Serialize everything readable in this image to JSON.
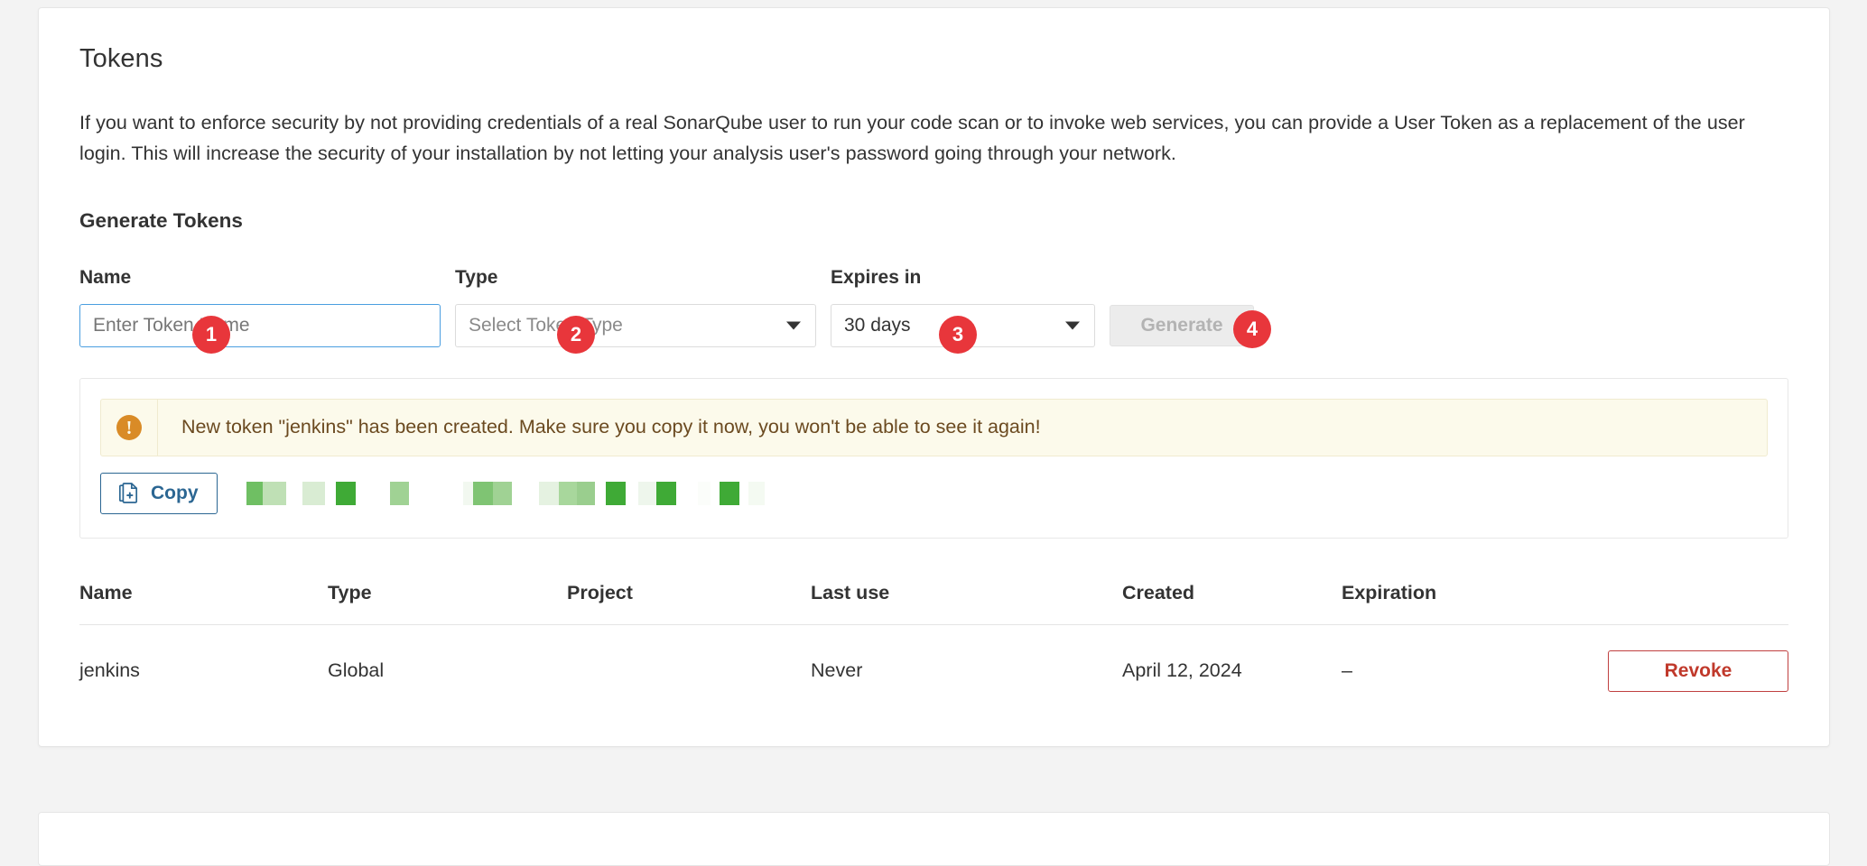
{
  "page": {
    "background_color": "#f3f3f3"
  },
  "card": {
    "title": "Tokens",
    "intro": "If you want to enforce security by not providing credentials of a real SonarQube user to run your code scan or to invoke web services, you can provide a User Token as a replacement of the user login. This will increase the security of your installation by not letting your analysis user's password going through your network.",
    "generate_section": {
      "heading": "Generate Tokens",
      "fields": {
        "name": {
          "label": "Name",
          "placeholder": "Enter Token Name",
          "value": ""
        },
        "type": {
          "label": "Type",
          "selected": "Select Token Type"
        },
        "expires_in": {
          "label": "Expires in",
          "selected": "30 days"
        }
      },
      "generate_button": {
        "label": "Generate",
        "disabled": true
      }
    },
    "step_badges": [
      {
        "number": "1"
      },
      {
        "number": "2"
      },
      {
        "number": "3"
      },
      {
        "number": "4"
      }
    ],
    "alert": {
      "icon": "exclamation-circle-icon",
      "icon_glyph": "!",
      "message": "New token \"jenkins\" has been created. Make sure you copy it now, you won't be able to see it again!",
      "accent_color": "#d98b27",
      "background_color": "#fcfaeb",
      "text_color": "#6b4a20"
    },
    "copy": {
      "label": "Copy",
      "icon": "copy-document-plus-icon",
      "token_value_redacted": true,
      "redaction_color": "#3faa36"
    },
    "table": {
      "columns": [
        "Name",
        "Type",
        "Project",
        "Last use",
        "Created",
        "Expiration",
        ""
      ],
      "rows": [
        {
          "name": "jenkins",
          "type": "Global",
          "project": "",
          "last_use": "Never",
          "created": "April 12, 2024",
          "expiration": "–",
          "action_label": "Revoke"
        }
      ]
    }
  }
}
